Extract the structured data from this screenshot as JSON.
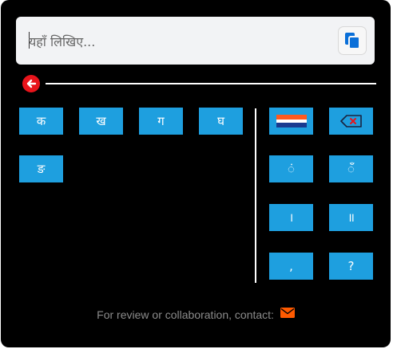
{
  "input": {
    "placeholder": "यहाँ लिखिए...",
    "value": ""
  },
  "letters": [
    {
      "name": "key-ka",
      "label": "क"
    },
    {
      "name": "key-kha",
      "label": "ख"
    },
    {
      "name": "key-ga",
      "label": "ग"
    },
    {
      "name": "key-gha",
      "label": "घ"
    },
    {
      "name": "key-nga",
      "label": "ङ"
    }
  ],
  "specials": {
    "anusvara": "ं",
    "chandrabindu": "ँ",
    "danda": "।",
    "double_danda": "॥",
    "comma": ",",
    "question": "?"
  },
  "icons": {
    "copy": "copy-icon",
    "back": "arrow-left-icon",
    "flag": "flag-icon",
    "backspace": "backspace-icon",
    "mail": "envelope-icon"
  },
  "colors": {
    "key_bg": "#1e9fdf",
    "panel_bg": "#000000",
    "back_red": "#e8141b",
    "mail_orange": "#ff5a00",
    "copy_blue": "#0a6fd8"
  },
  "footer": {
    "text": "For review or collaboration, contact:"
  }
}
